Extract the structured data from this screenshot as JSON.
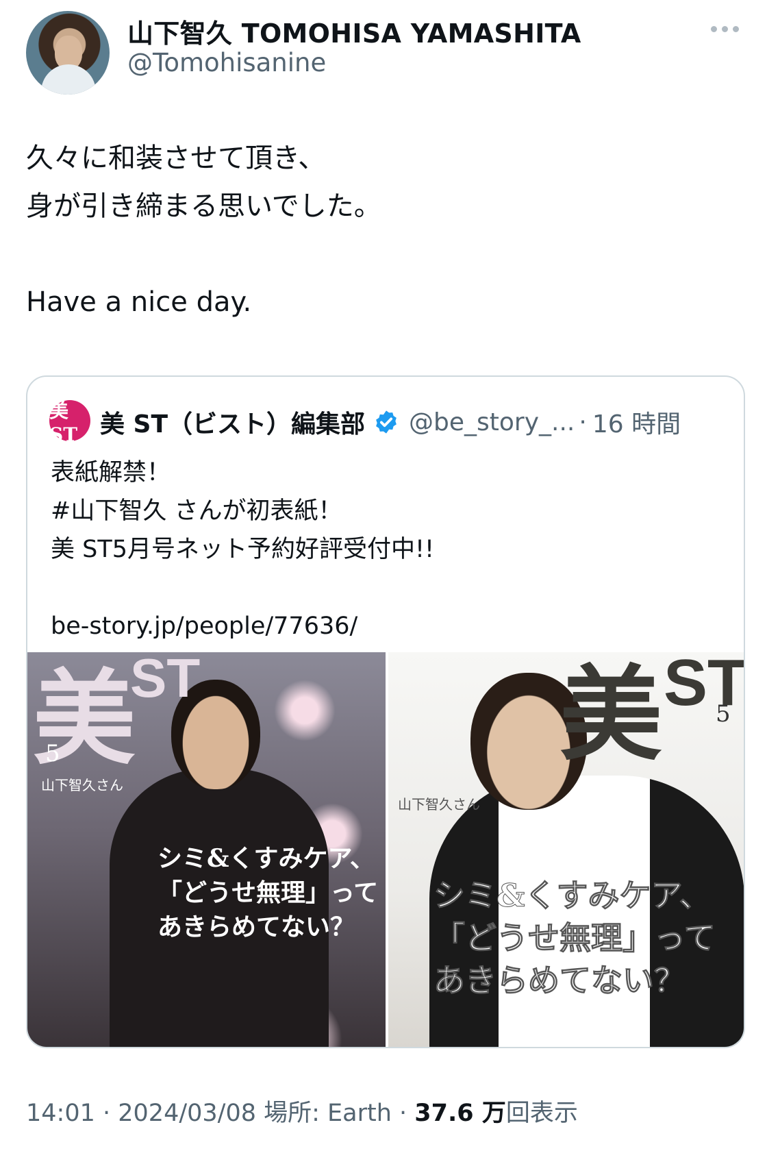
{
  "author": {
    "name": "山下智久 TOMOHISA YAMASHITA",
    "handle": "@Tomohisanine"
  },
  "tweet": {
    "lines": [
      "久々に和装させて頂き、",
      "身が引き締まる思いでした。",
      "",
      "Have a nice day."
    ]
  },
  "quoted": {
    "logo_text": "美ST",
    "name": "美 ST（ビスト）編集部",
    "handle": "@be_story_...",
    "separator": "·",
    "time": "16 時間",
    "lines": [
      "表紙解禁！",
      "#山下智久 さんが初表紙！",
      "美 ST5月号ネット予約好評受付中!!",
      "",
      "be-story.jp/people/77636/"
    ]
  },
  "covers": {
    "left": {
      "mast": "美",
      "mast_st": "ST",
      "issue": "5",
      "cover_label": "山下智久さん",
      "headline": [
        "シミ&くすみケア、",
        "「どうせ無理」って",
        "あきらめてない？"
      ]
    },
    "right": {
      "mast": "美",
      "mast_st": "ST",
      "issue": "5",
      "cover_label": "山下智久さん",
      "headline": [
        "シミ&くすみケア、",
        "「どうせ無理」って",
        "あきらめてない？"
      ]
    }
  },
  "meta": {
    "time": "14:01",
    "sep1": " · ",
    "date": "2024/03/08",
    "location": " 場所: Earth",
    "sep2": " · ",
    "views_count": "37.6 万",
    "views_label": "回表示"
  },
  "colors": {
    "accent": "#1d9bf0",
    "secondary_text": "#536471",
    "border": "#cfd9de",
    "logo_bg": "#d6216b"
  },
  "icons": {
    "more": "more-icon",
    "verified": "verified-badge-icon"
  }
}
